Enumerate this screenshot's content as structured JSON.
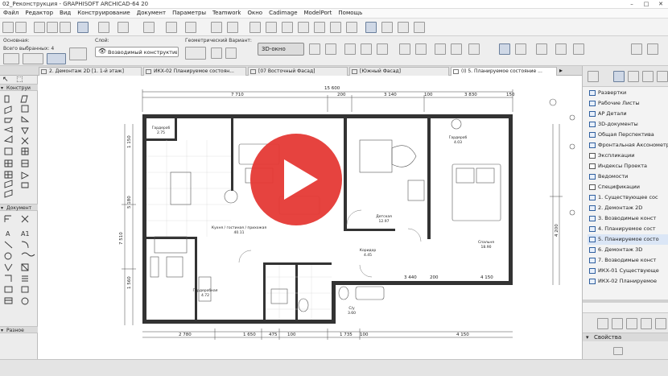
{
  "window": {
    "title": "02_Реконструкция - GRAPHISOFT ARCHICAD-64 20",
    "min_label": "–",
    "max_label": "□",
    "close_label": "✕"
  },
  "menu": [
    "Файл",
    "Редактор",
    "Вид",
    "Конструирование",
    "Документ",
    "Параметры",
    "Teamwork",
    "Окно",
    "Cadimage",
    "ModelPort",
    "Помощь"
  ],
  "info_box": {
    "main_label": "Основная:",
    "selected_label": "Всего выбранных: 4",
    "layer_label": "Слой:",
    "layer_value": "Возводимый конструктив",
    "geometry_label": "Геометрический Вариант:",
    "window_3d_label": "3D-окно"
  },
  "tabs": [
    {
      "label": "2. Демонтаж 2D [1. 1-й этаж]",
      "active": false
    },
    {
      "label": "ИКХ-02 Планируемое состоян...",
      "active": false
    },
    {
      "label": "[07 Восточный Фасад]",
      "active": false
    },
    {
      "label": "[Южный Фасад]",
      "active": false
    },
    {
      "label": "(I) 5. Планируемое состояние ...",
      "active": true
    }
  ],
  "left_panel": {
    "sections": [
      "Конструи",
      "Документ",
      "Разное"
    ]
  },
  "plan": {
    "dimensions_top": [
      "15 600",
      "7 710",
      "200",
      "3 140",
      "100",
      "3 830",
      "150"
    ],
    "dimensions_bottom": [
      "2 780",
      "1 650",
      "475",
      "100",
      "1 735",
      "100",
      "4 150"
    ],
    "dimensions_left": [
      "5 180",
      "7 510",
      "1 150",
      "1 560"
    ],
    "dimensions_right": [
      "3 440",
      "200",
      "4 150",
      "4 200"
    ],
    "rooms": [
      {
        "name": "Кухня / гостиная / прихожая",
        "area": "40.11"
      },
      {
        "name": "Гардероб",
        "area": "2.75"
      },
      {
        "name": "Гардероб",
        "area": "4.03"
      },
      {
        "name": "Детская",
        "area": "12.97"
      },
      {
        "name": "Коридор",
        "area": "4.45"
      },
      {
        "name": "Спальня",
        "area": "18.90"
      },
      {
        "name": "Гардеробная",
        "area": "4.72"
      },
      {
        "name": "С/у",
        "area": "3.60"
      }
    ]
  },
  "navigator": {
    "items": [
      {
        "label": "Развертки",
        "type": "view",
        "selected": false
      },
      {
        "label": "Рабочие Листы",
        "type": "view",
        "selected": false
      },
      {
        "label": "АР Детали",
        "type": "view",
        "selected": false
      },
      {
        "label": "3D-документы",
        "type": "view",
        "selected": false
      },
      {
        "label": "Общая Перспектива",
        "type": "view",
        "selected": false
      },
      {
        "label": "Фронтальная Аксонометрия",
        "type": "view",
        "selected": false
      },
      {
        "label": "Экспликации",
        "type": "folder",
        "selected": false
      },
      {
        "label": "Индексы Проекта",
        "type": "folder",
        "selected": false
      },
      {
        "label": "Ведомости",
        "type": "view",
        "selected": false
      },
      {
        "label": "Спецификации",
        "type": "folder",
        "selected": false
      },
      {
        "label": "1. Существующее сос",
        "type": "plan",
        "selected": false
      },
      {
        "label": "2. Демонтаж 2D",
        "type": "plan",
        "selected": false
      },
      {
        "label": "3. Возводимые конст",
        "type": "plan",
        "selected": false
      },
      {
        "label": "4. Планируемое сост",
        "type": "plan",
        "selected": false
      },
      {
        "label": "5. Планируемое состо",
        "type": "plan",
        "selected": true
      },
      {
        "label": "6. Демонтаж 3D",
        "type": "plan",
        "selected": false
      },
      {
        "label": "7. Возводимые конст",
        "type": "plan",
        "selected": false
      },
      {
        "label": "ИКХ-01 Существующе",
        "type": "table",
        "selected": false
      },
      {
        "label": "ИКХ-02 Планируемое",
        "type": "table",
        "selected": false
      }
    ],
    "properties_label": "Свойства"
  },
  "play_button": {
    "icon": "play-icon",
    "color": "#e53935"
  }
}
